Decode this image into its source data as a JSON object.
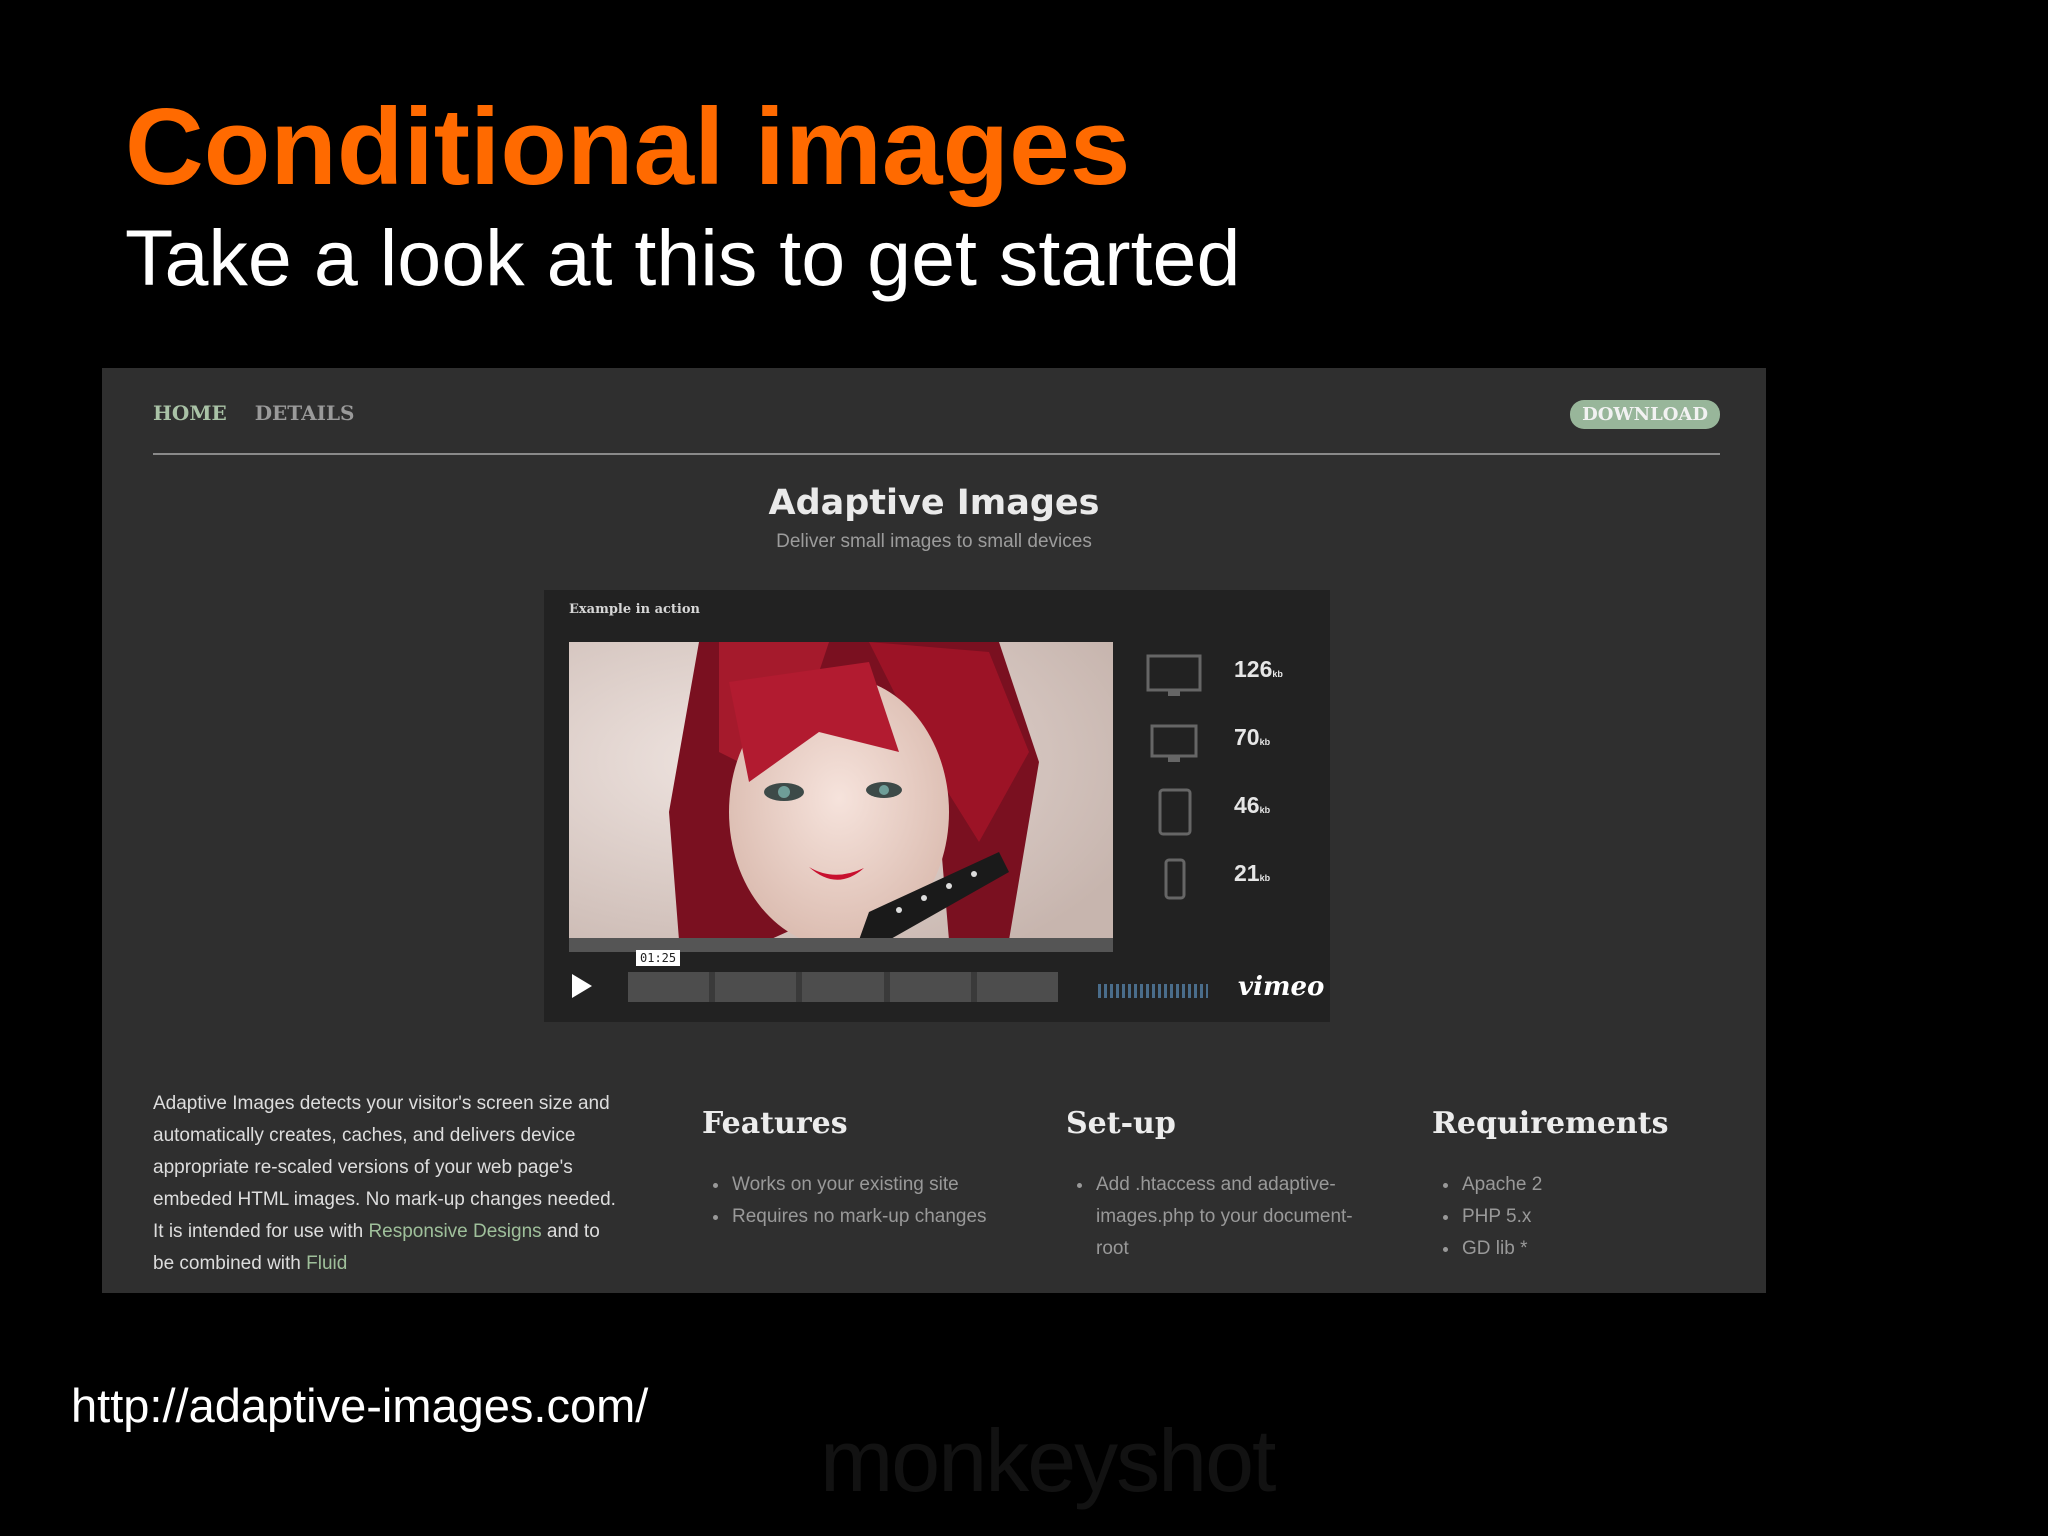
{
  "slide": {
    "title": "Conditional images",
    "subtitle": "Take a look at this to get started",
    "url": "http://adaptive-images.com/",
    "watermark": "monkeyshot"
  },
  "site": {
    "nav": {
      "home": "HOME",
      "details": "DETAILS"
    },
    "download_label": "DOWNLOAD",
    "title": "Adaptive Images",
    "tagline": "Deliver small images to small devices",
    "player": {
      "label": "Example in action",
      "timecode": "01:25",
      "brand": "vimeo",
      "stats": [
        {
          "device": "desktop-icon",
          "value": "126",
          "unit": "kb"
        },
        {
          "device": "laptop-icon",
          "value": "70",
          "unit": "kb"
        },
        {
          "device": "tablet-icon",
          "value": "46",
          "unit": "kb"
        },
        {
          "device": "phone-icon",
          "value": "21",
          "unit": "kb"
        }
      ]
    },
    "intro": {
      "text_before": "Adaptive Images detects your visitor's screen size and automatically creates, caches, and delivers device appropriate re-scaled versions of your web page's embeded HTML images. No mark-up changes needed. It is intended for use with ",
      "link1": "Responsive Designs",
      "text_middle": " and to be combined with ",
      "link2": "Fluid"
    },
    "features": {
      "heading": "Features",
      "items": [
        "Works on your existing site",
        "Requires no mark-up changes"
      ]
    },
    "setup": {
      "heading": "Set-up",
      "items": [
        "Add .htaccess and adaptive-images.php to your document-root"
      ]
    },
    "requirements": {
      "heading": "Requirements",
      "items": [
        "Apache 2",
        "PHP 5.x",
        "GD lib *"
      ]
    }
  },
  "colors": {
    "title": "#ff6a00",
    "accent_green": "#98b69a",
    "background": "#000000",
    "screenshot_bg": "#2f2f2f"
  }
}
